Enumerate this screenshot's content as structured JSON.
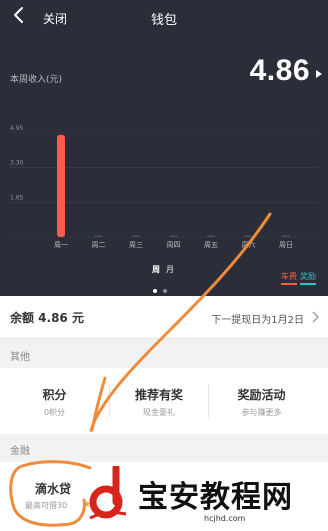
{
  "navbar": {
    "back_icon": "chevron-left-icon",
    "close_label": "关闭",
    "title": "钱包"
  },
  "week": {
    "label": "本周收入(元)",
    "amount": "4.86",
    "arrow_icon": "caret-right-icon"
  },
  "chart_data": {
    "type": "bar",
    "categories": [
      "周一",
      "周二",
      "周三",
      "周四",
      "周五",
      "周六",
      "周日"
    ],
    "series": [
      {
        "name": "车费",
        "values": [
          4.86,
          0,
          0,
          0,
          0,
          0,
          0
        ],
        "color": "#ff5b4c"
      },
      {
        "name": "奖励",
        "values": [
          0,
          0,
          0,
          0,
          0,
          0,
          0
        ],
        "color": "#2ec4c4"
      }
    ],
    "yticks": [
      "4.95",
      "3.30",
      "1.65"
    ],
    "ylim": [
      0,
      4.95
    ],
    "grid": true,
    "legend": "bottom-right"
  },
  "legend": {
    "cost": "车费",
    "reward": "奖励"
  },
  "periods": {
    "week": "周",
    "month": "月"
  },
  "balance": {
    "text": "余额 4.86 元",
    "next_withdraw": "下一提现日为1月2日",
    "chevron_icon": "chevron-right-icon"
  },
  "sections": {
    "other": "其他",
    "finance": "金融"
  },
  "other_items": [
    {
      "title": "积分",
      "sub": "0积分"
    },
    {
      "title": "推荐有奖",
      "sub": "现金豪礼"
    },
    {
      "title": "奖励活动",
      "sub": "参与赚更多"
    }
  ],
  "finance": {
    "loan_title": "滴水贷",
    "loan_sub": "最高可借30",
    "star_icon": "star-icon"
  },
  "watermark": {
    "text": "宝安教程网",
    "url": "hcjhd.com"
  },
  "colors": {
    "header_bg": "#2b2e38",
    "bar": "#ff5b4c",
    "reward": "#2ec4c4",
    "annotation": "#f08a3c"
  }
}
